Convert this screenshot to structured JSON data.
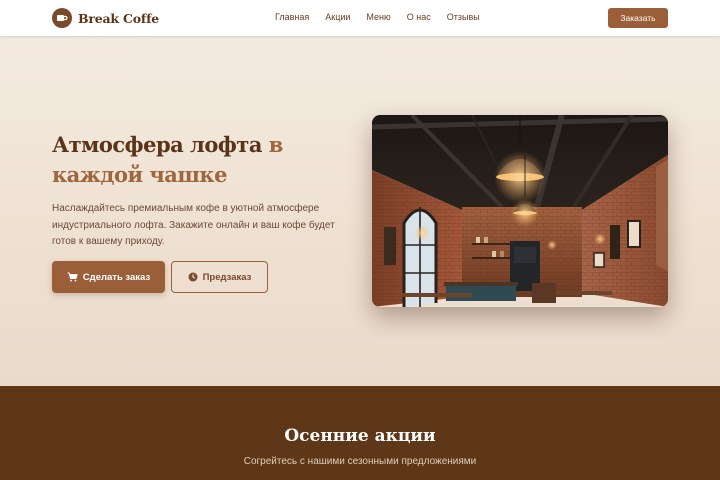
{
  "brand": {
    "name": "Break Coffe",
    "logo_icon": "coffee-cup-icon",
    "color": "#7a4a2a"
  },
  "nav": {
    "items": [
      {
        "label": "Главная"
      },
      {
        "label": "Акции"
      },
      {
        "label": "Меню"
      },
      {
        "label": "О нас"
      },
      {
        "label": "Отзывы"
      }
    ],
    "order_label": "Заказать"
  },
  "hero": {
    "title_main": "Атмосфера лофта",
    "title_accent": "в каждой чашке",
    "description": "Наслаждайтесь премиальным кофе в уютной атмосфере индустриального лофта. Закажите онлайн и ваш кофе будет готов к вашему приходу.",
    "primary_button": {
      "label": "Сделать заказ",
      "icon": "cart-icon"
    },
    "secondary_button": {
      "label": "Предзаказ",
      "icon": "clock-icon"
    },
    "image": "loft-cafe-interior"
  },
  "promo": {
    "title": "Осенние акции",
    "subtitle": "Согрейтесь с нашими сезонными предложениями"
  },
  "colors": {
    "accent": "#9a5e38",
    "dark": "#5e3719",
    "title": "#5a3418",
    "title_accent": "#a0673e",
    "background": "#efe3d6"
  }
}
